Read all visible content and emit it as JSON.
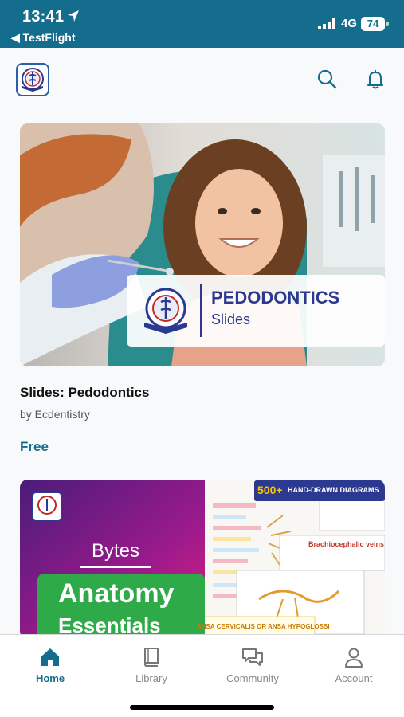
{
  "status_bar": {
    "time": "13:41",
    "back_label": "◀ TestFlight",
    "network": "4G",
    "battery": "74"
  },
  "header": {
    "logo_icon": "ecdentistry-logo",
    "search_icon": "search-icon",
    "notifications_icon": "bell-icon"
  },
  "feed": {
    "cards": [
      {
        "banner_title": "PEDODONTICS",
        "banner_subtitle": "Slides",
        "title": "Slides: Pedodontics",
        "author": "by Ecdentistry",
        "price": "Free"
      },
      {
        "line1": "Bytes",
        "line2": "Anatomy",
        "line3": "Essentials",
        "badge_number": "500+",
        "badge_text": "HAND-DRAWN DIAGRAMS",
        "note_heading": "Brachiocephalic veins",
        "note_footer": "ANSA CERVICALIS OR ANSA HYPOGLOSSI"
      }
    ]
  },
  "tabbar": {
    "tabs": [
      {
        "label": "Home",
        "icon": "home-icon",
        "active": true
      },
      {
        "label": "Library",
        "icon": "book-icon",
        "active": false
      },
      {
        "label": "Community",
        "icon": "chat-icon",
        "active": false
      },
      {
        "label": "Account",
        "icon": "person-icon",
        "active": false
      }
    ]
  },
  "colors": {
    "brand": "#156d8e",
    "accent_navy": "#2b3990",
    "green": "#2eaa48"
  }
}
